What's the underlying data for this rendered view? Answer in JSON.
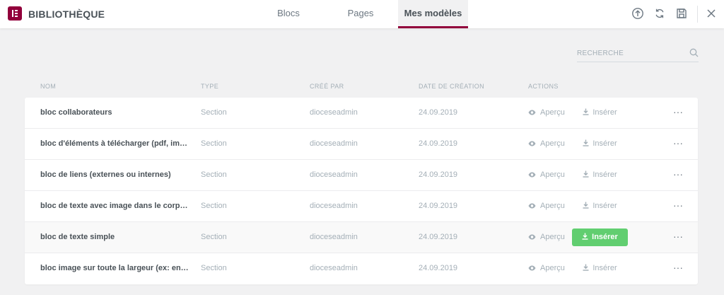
{
  "header": {
    "title": "BIBLIOTHÈQUE",
    "logo_icon": "elementor-logo-icon",
    "brand_color": "#92003b",
    "tabs": [
      {
        "label": "Blocs",
        "active": false
      },
      {
        "label": "Pages",
        "active": false
      },
      {
        "label": "Mes modèles",
        "active": true
      }
    ],
    "toolbar_icons": [
      "upload-icon",
      "sync-icon",
      "save-icon",
      "close-icon"
    ]
  },
  "search": {
    "placeholder": "RECHERCHE",
    "value": ""
  },
  "table": {
    "columns": [
      "NOM",
      "TYPE",
      "CRÉÉ PAR",
      "DATE DE CRÉATION",
      "ACTIONS"
    ],
    "preview_label": "Aperçu",
    "insert_label": "Insérer",
    "more_label": "···",
    "insert_highlight_color": "#61ce70",
    "rows": [
      {
        "name": "bloc collaborateurs",
        "type": "Section",
        "author": "dioceseadmin",
        "date": "24.09.2019"
      },
      {
        "name": "bloc d'éléments à télécharger (pdf, image, d...",
        "type": "Section",
        "author": "dioceseadmin",
        "date": "24.09.2019"
      },
      {
        "name": "bloc de liens (externes ou internes)",
        "type": "Section",
        "author": "dioceseadmin",
        "date": "24.09.2019"
      },
      {
        "name": "bloc de texte avec image dans le corps du t...",
        "type": "Section",
        "author": "dioceseadmin",
        "date": "24.09.2019"
      },
      {
        "name": "bloc de texte simple",
        "type": "Section",
        "author": "dioceseadmin",
        "date": "24.09.2019",
        "hovered": true
      },
      {
        "name": "bloc image sur toute la largeur (ex: en-tête ...",
        "type": "Section",
        "author": "dioceseadmin",
        "date": "24.09.2019"
      }
    ]
  }
}
